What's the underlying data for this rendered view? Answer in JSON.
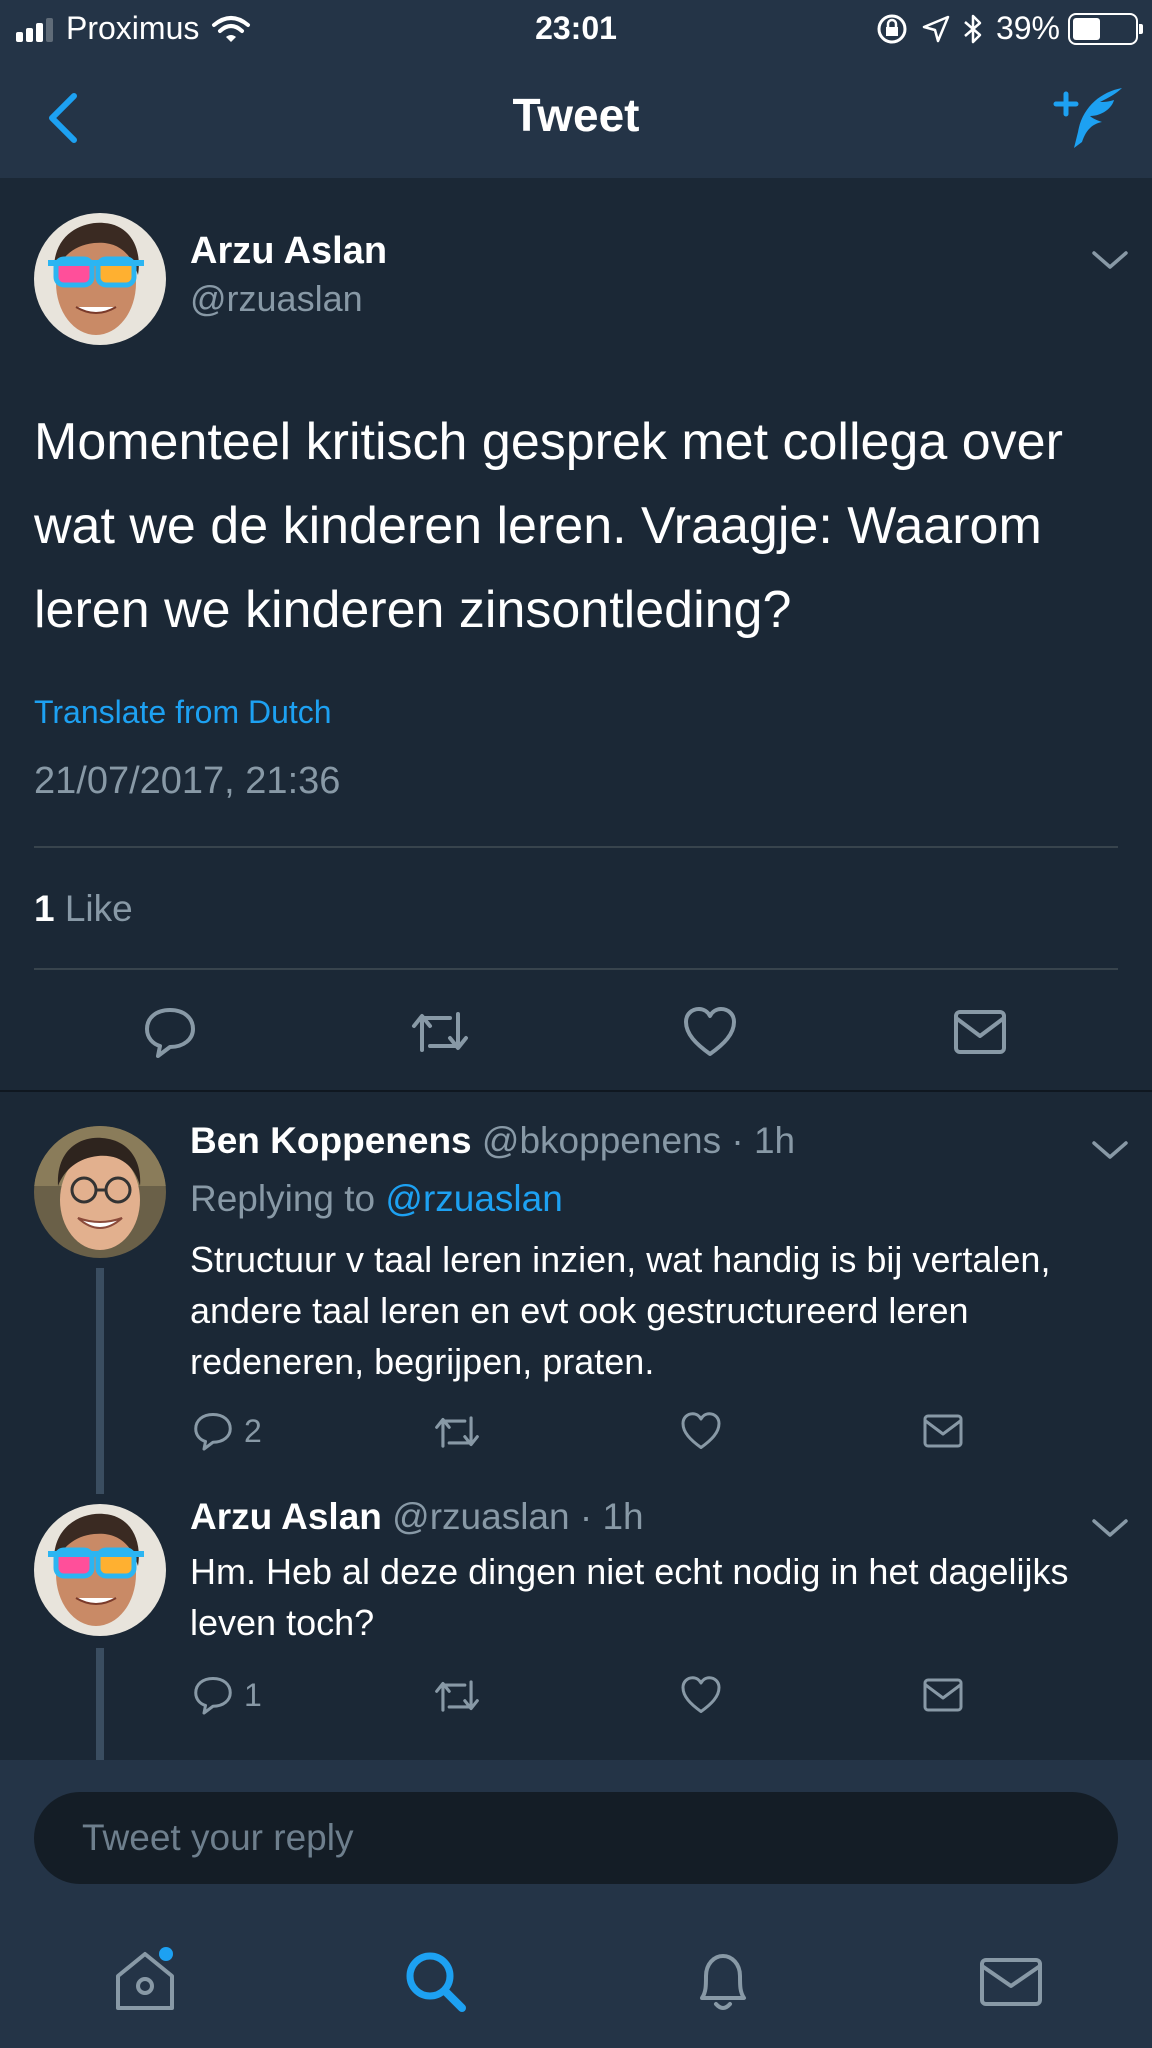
{
  "status_bar": {
    "carrier": "Proximus",
    "time": "23:01",
    "battery": "39%"
  },
  "nav": {
    "title": "Tweet"
  },
  "tweet": {
    "author_name": "Arzu Aslan",
    "author_handle": "@rzuaslan",
    "text": "Momenteel kritisch gesprek met collega over wat we de kinderen leren. Vraagje: Waarom leren we kinderen zinsontleding?",
    "translate": "Translate from Dutch",
    "timestamp": "21/07/2017, 21:36",
    "like_count": "1",
    "like_label": "Like"
  },
  "replies": [
    {
      "name": "Ben Koppenens",
      "handle": "@bkoppenens · 1h",
      "replying_prefix": "Replying to",
      "replying_handle": "@rzuaslan",
      "text": "Structuur v taal leren inzien, wat handig is bij vertalen, andere taal leren en evt ook gestructureerd leren redeneren, begrijpen, praten.",
      "reply_count": "2"
    },
    {
      "name": "Arzu Aslan",
      "handle": "@rzuaslan · 1h",
      "text": "Hm. Heb al deze dingen niet echt nodig in het dagelijks leven toch?",
      "reply_count": "1"
    }
  ],
  "composer": {
    "placeholder": "Tweet your reply"
  },
  "colors": {
    "background": "#1b2836",
    "bar": "#243447",
    "accent": "#1da1f2",
    "muted": "#8899a6"
  },
  "icons": [
    "back-icon",
    "compose-icon",
    "reply-icon",
    "retweet-icon",
    "like-icon",
    "dm-icon",
    "home-icon",
    "search-icon",
    "notifications-icon",
    "messages-icon"
  ]
}
